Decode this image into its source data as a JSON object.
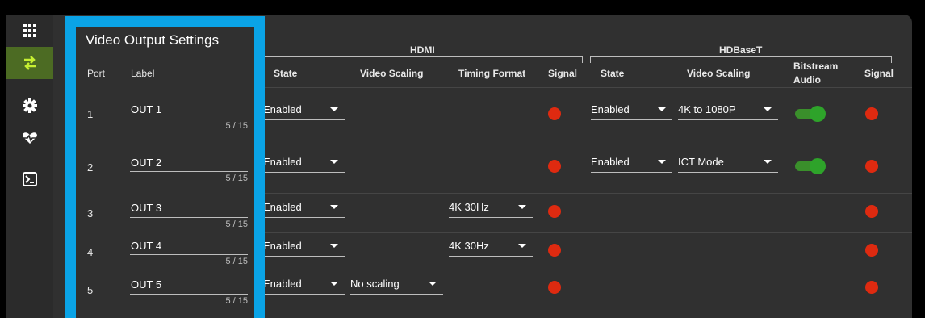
{
  "sidebar": {
    "items": [
      {
        "icon": "apps-grid-icon"
      },
      {
        "icon": "swap-arrows-icon",
        "active": true
      },
      {
        "icon": "gear-icon"
      },
      {
        "icon": "heart-pulse-icon"
      },
      {
        "icon": "terminal-icon"
      }
    ]
  },
  "panel": {
    "title": "Video Output Settings"
  },
  "groups": {
    "hdmi": "HDMI",
    "hdbaset": "HDBaseT"
  },
  "columns": {
    "port": "Port",
    "label": "Label",
    "hdmi_state": "State",
    "hdmi_video_scaling": "Video Scaling",
    "hdmi_timing_format": "Timing Format",
    "hdmi_signal": "Signal",
    "hdbt_state": "State",
    "hdbt_video_scaling": "Video Scaling",
    "bitstream_audio_1": "Bitstream",
    "bitstream_audio_2": "Audio",
    "hdbt_signal": "Signal"
  },
  "rows": [
    {
      "port": "1",
      "label": "OUT 1",
      "counter": "5 / 15",
      "hdmi_state": "Enabled",
      "hdbt_state": "Enabled",
      "hdbt_scaling": "4K to 1080P",
      "bitstream_audio": true
    },
    {
      "port": "2",
      "label": "OUT 2",
      "counter": "5 / 15",
      "hdmi_state": "Enabled",
      "hdbt_state": "Enabled",
      "hdbt_scaling": "ICT Mode",
      "bitstream_audio": true
    },
    {
      "port": "3",
      "label": "OUT 3",
      "counter": "5 / 15",
      "hdmi_state": "Enabled",
      "timing_format": "4K 30Hz"
    },
    {
      "port": "4",
      "label": "OUT 4",
      "counter": "5 / 15",
      "hdmi_state": "Enabled",
      "timing_format": "4K 30Hz"
    },
    {
      "port": "5",
      "label": "OUT 5",
      "counter": "5 / 15",
      "hdmi_state": "Enabled",
      "hdmi_scaling": "No scaling"
    }
  ],
  "colors": {
    "highlight": "#0aa3e6",
    "signal_off": "#de2a10",
    "toggle_on": "#2ea32a",
    "nav_active": "#4c6b23"
  }
}
